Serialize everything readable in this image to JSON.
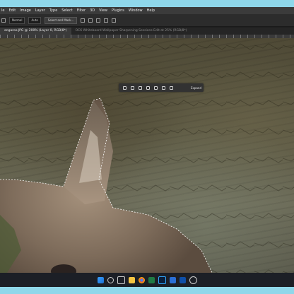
{
  "menubar": {
    "items": [
      "le",
      "Edit",
      "Image",
      "Layer",
      "Type",
      "Select",
      "Filter",
      "3D",
      "View",
      "Plugins",
      "Window",
      "Help"
    ]
  },
  "options": {
    "mode_field": "Normal",
    "width_field": "Auto",
    "height_field": "",
    "mask_button": "Select and Mask...",
    "contextual_field": "Select Subject"
  },
  "tabs": {
    "active_label": "angaroo.JPG @ 200% (Layer 0, RGB/8*)",
    "inactive_label": "OC6 Whiteboard Wallpaper Sharpening Sessions Edit at 25% (RGB/8*)"
  },
  "context_bar": {
    "generate_label": "Expand"
  },
  "taskbar": {
    "time": "",
    "date": ""
  }
}
